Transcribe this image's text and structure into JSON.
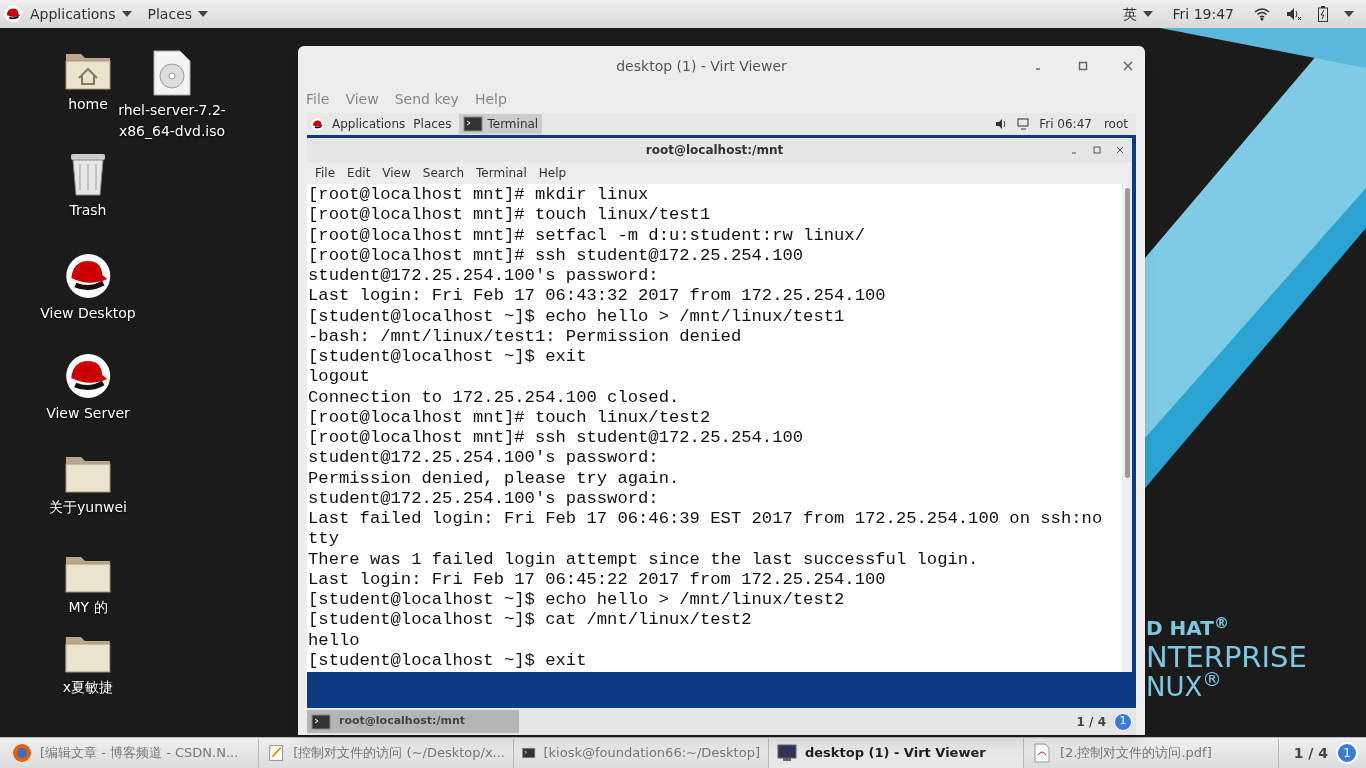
{
  "top_bar": {
    "menus": [
      "Applications",
      "Places"
    ],
    "input_method": "英",
    "clock": "Fri 19:47"
  },
  "desktop_icons": [
    {
      "kind": "home",
      "label": "home"
    },
    {
      "kind": "disc",
      "label": "rhel-server-7.2-x86_64-dvd.iso"
    },
    {
      "kind": "trash",
      "label": "Trash"
    },
    {
      "kind": "redhat",
      "label": "View Desktop"
    },
    {
      "kind": "redhat",
      "label": "View Server"
    },
    {
      "kind": "folder",
      "label": "关于yunwei"
    },
    {
      "kind": "folder",
      "label": "MY 的"
    },
    {
      "kind": "folder",
      "label": "x夏敏捷"
    }
  ],
  "wallpaper_text": [
    "D HAT$^{®}$",
    "NTERPRISE",
    "NUX$^{®}$"
  ],
  "viewer": {
    "title": "desktop (1) - Virt Viewer",
    "menu": [
      "File",
      "View",
      "Send key",
      "Help"
    ],
    "guest": {
      "top_bar": {
        "menus": [
          "Applications",
          "Places"
        ],
        "task": "Terminal",
        "clock": "Fri 06:47",
        "user": "root"
      },
      "terminal": {
        "title": "root@localhost:/mnt",
        "menu": [
          "File",
          "Edit",
          "View",
          "Search",
          "Terminal",
          "Help"
        ],
        "lines": [
          "[root@localhost mnt]# mkdir linux",
          "[root@localhost mnt]# touch linux/test1",
          "[root@localhost mnt]# setfacl -m d:u:student:rw linux/",
          "[root@localhost mnt]# ssh student@172.25.254.100",
          "student@172.25.254.100's password:",
          "Last login: Fri Feb 17 06:43:32 2017 from 172.25.254.100",
          "[student@localhost ~]$ echo hello > /mnt/linux/test1",
          "-bash: /mnt/linux/test1: Permission denied",
          "[student@localhost ~]$ exit",
          "logout",
          "Connection to 172.25.254.100 closed.",
          "[root@localhost mnt]# touch linux/test2",
          "[root@localhost mnt]# ssh student@172.25.254.100",
          "student@172.25.254.100's password:",
          "Permission denied, please try again.",
          "student@172.25.254.100's password:",
          "Last failed login: Fri Feb 17 06:46:39 EST 2017 from 172.25.254.100 on ssh:no",
          "tty",
          "There was 1 failed login attempt since the last successful login.",
          "Last login: Fri Feb 17 06:45:22 2017 from 172.25.254.100",
          "[student@localhost ~]$ echo hello > /mnt/linux/test2",
          "[student@localhost ~]$ cat /mnt/linux/test2",
          "hello",
          "[student@localhost ~]$ exit"
        ]
      },
      "taskbar": {
        "items": [
          {
            "label": "root@localhost:/mnt",
            "selected": true
          }
        ],
        "pager": "1 / 4",
        "workspace": "1"
      }
    }
  },
  "taskbar": {
    "items": [
      {
        "kind": "browser",
        "label": "[编辑文章 - 博客频道 - CSDN.N...",
        "selected": false
      },
      {
        "kind": "editor",
        "label": "[控制对文件的访问 (~/Desktop/x...",
        "selected": false
      },
      {
        "kind": "terminal",
        "label": "[kiosk@foundation66:~/Desktop]",
        "selected": false
      },
      {
        "kind": "monitor",
        "label": "desktop (1) - Virt Viewer",
        "selected": true
      },
      {
        "kind": "pdf",
        "label": "[2.控制对文件的访问.pdf]",
        "selected": false
      }
    ],
    "pager": "1 / 4",
    "workspace": "1"
  }
}
